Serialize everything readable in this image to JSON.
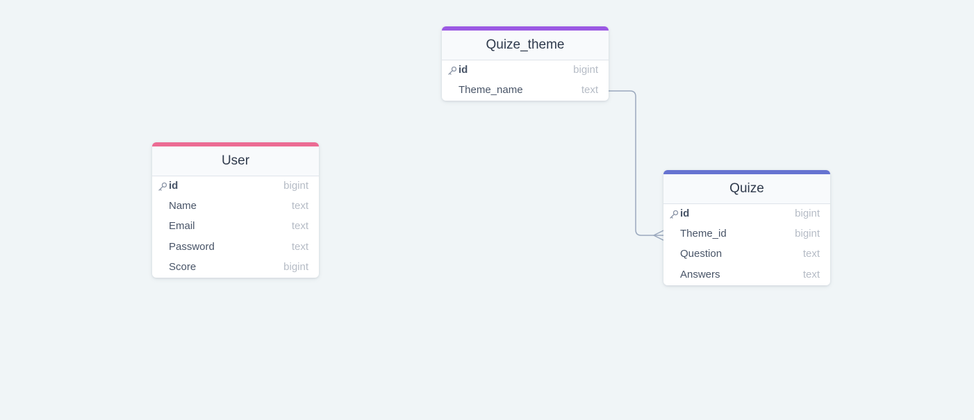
{
  "accents": {
    "user": "#ec6b93",
    "quize_theme": "#9b59e3",
    "quize": "#6673d1"
  },
  "tables": {
    "user": {
      "title": "User",
      "columns": [
        {
          "name": "id",
          "type": "bigint",
          "pk": true
        },
        {
          "name": "Name",
          "type": "text"
        },
        {
          "name": "Email",
          "type": "text"
        },
        {
          "name": "Password",
          "type": "text"
        },
        {
          "name": "Score",
          "type": "bigint"
        }
      ]
    },
    "quize_theme": {
      "title": "Quize_theme",
      "columns": [
        {
          "name": "id",
          "type": "bigint",
          "pk": true
        },
        {
          "name": "Theme_name",
          "type": "text"
        }
      ]
    },
    "quize": {
      "title": "Quize",
      "columns": [
        {
          "name": "id",
          "type": "bigint",
          "pk": true
        },
        {
          "name": "Theme_id",
          "type": "bigint"
        },
        {
          "name": "Question",
          "type": "text"
        },
        {
          "name": "Answers",
          "type": "text"
        }
      ]
    }
  },
  "relations": [
    {
      "from": "quize_theme.Theme_name",
      "to": "quize.Theme_id",
      "cardinality": "one-to-many"
    }
  ],
  "icons": {
    "primary_key": "key-icon"
  }
}
